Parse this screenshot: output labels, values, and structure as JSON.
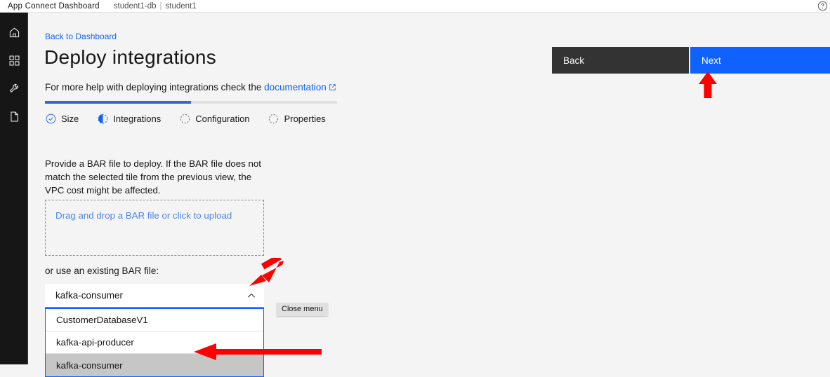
{
  "topbar": {
    "brand": "App Connect Dashboard",
    "context_namespace": "student1-db",
    "context_separator": "|",
    "context_user": "student1",
    "help_icon": "help-circle-icon"
  },
  "sidebar": {
    "items": [
      {
        "icon": "home-icon",
        "name": "home"
      },
      {
        "icon": "grid-apps-icon",
        "name": "catalog"
      },
      {
        "icon": "wrench-icon",
        "name": "tools"
      },
      {
        "icon": "document-icon",
        "name": "documents"
      }
    ]
  },
  "page": {
    "back_link": "Back to Dashboard",
    "title": "Deploy integrations",
    "subtitle_prefix": "For more help with deploying integrations check the ",
    "subtitle_link": "documentation",
    "subtitle_link_icon": "external-link-icon"
  },
  "progress": {
    "fill_percent": 50,
    "steps": [
      {
        "label": "Size",
        "state": "complete",
        "icon": "check-circle-icon"
      },
      {
        "label": "Integrations",
        "state": "current",
        "icon": "half-circle-icon"
      },
      {
        "label": "Configuration",
        "state": "incomplete",
        "icon": "dashed-circle-icon"
      },
      {
        "label": "Properties",
        "state": "incomplete",
        "icon": "dashed-circle-icon"
      }
    ]
  },
  "content": {
    "description": "Provide a BAR file to deploy. If the BAR file does not match the selected tile from the previous view, the VPC cost might be affected.",
    "dropzone_label": "Drag and drop a BAR file or click to upload",
    "existing_label": "or use an existing BAR file:"
  },
  "combobox": {
    "value": "kafka-consumer",
    "chevron_icon": "chevron-up-icon",
    "expanded": true,
    "tooltip": "Close menu",
    "options": [
      {
        "label": "CustomerDatabaseV1",
        "selected": false
      },
      {
        "label": "kafka-api-producer",
        "selected": false
      },
      {
        "label": "kafka-consumer",
        "selected": true
      }
    ]
  },
  "actions": {
    "back_label": "Back",
    "next_label": "Next"
  },
  "colors": {
    "accent_blue": "#0f62fe",
    "link_blue": "#0f62fe",
    "back_button": "#333333",
    "page_background": "#f4f4f4",
    "rail_background": "#161616",
    "selected_option": "#c6c6c6",
    "annotation_red": "#ff0000"
  },
  "annotations": [
    {
      "name": "arrow-to-next-button",
      "direction": "up",
      "target": "Next"
    },
    {
      "name": "arrow-to-combobox-chevron",
      "direction": "down-left",
      "target": "Close menu chevron"
    },
    {
      "name": "arrow-to-selected-option",
      "direction": "left",
      "target": "kafka-consumer option"
    }
  ]
}
